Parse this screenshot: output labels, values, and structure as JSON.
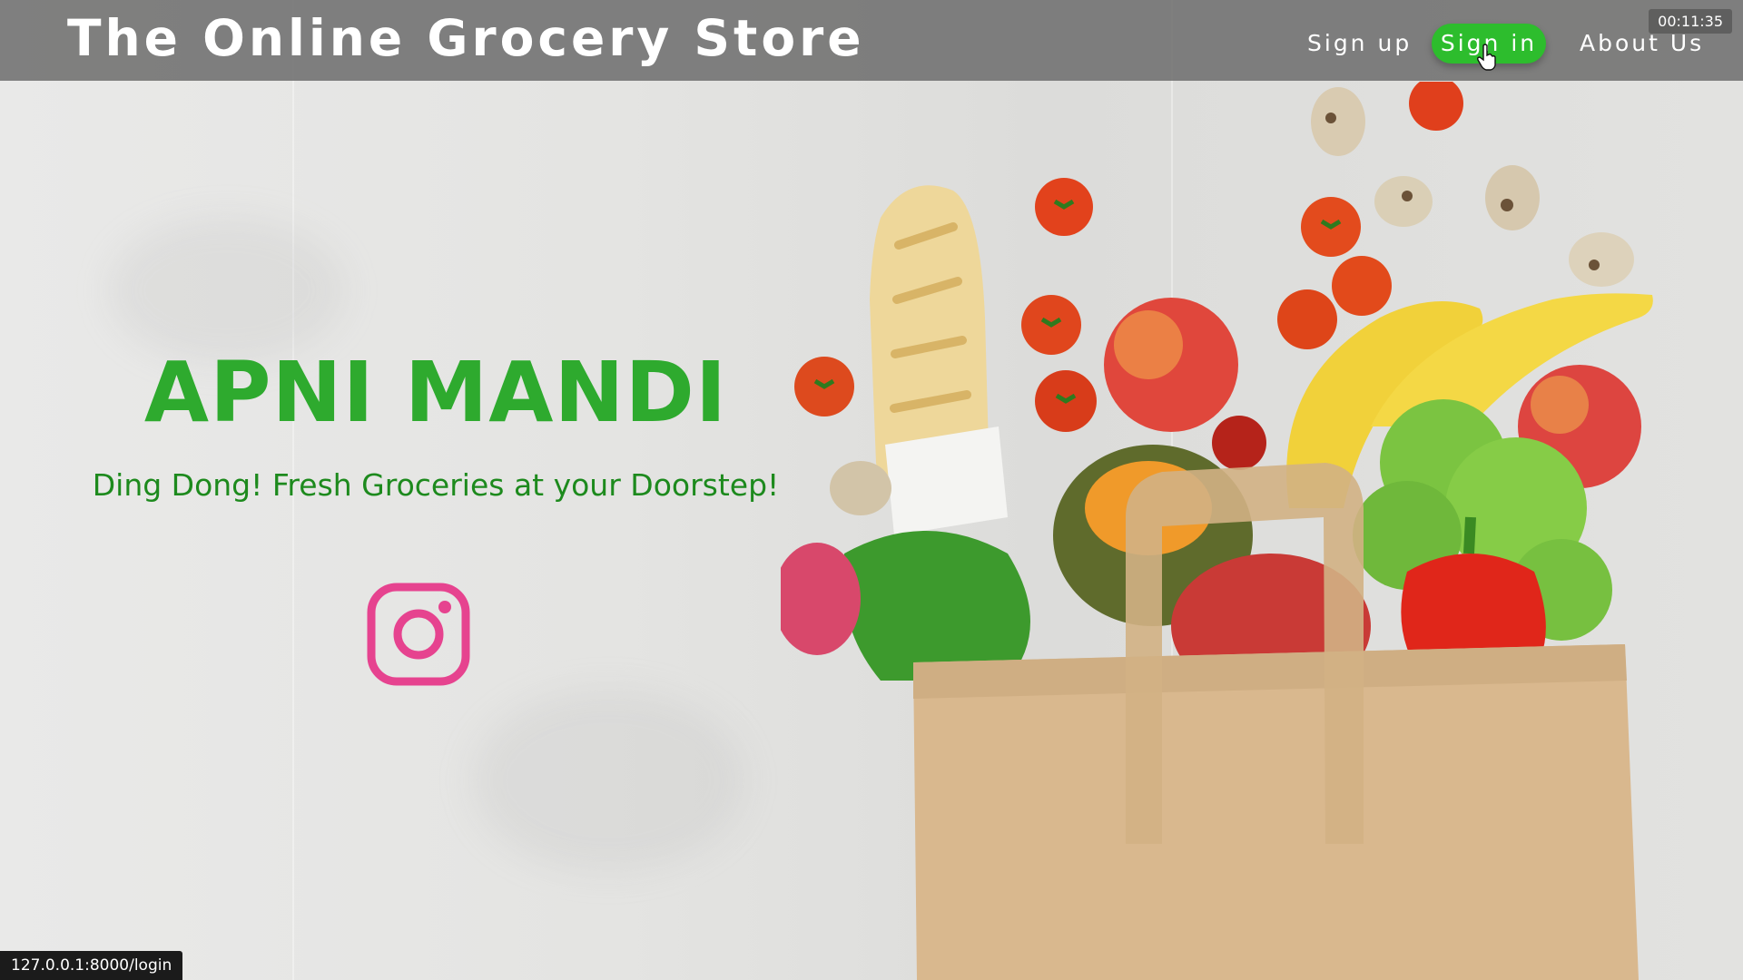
{
  "header": {
    "site_title": "The Online Grocery Store",
    "nav": {
      "signup": "Sign up",
      "signin": "Sign in",
      "about": "About Us"
    },
    "timer": "00:11:35"
  },
  "hero": {
    "title": "APNI MANDI",
    "tagline": "Ding Dong! Fresh Groceries at your Doorstep!"
  },
  "icons": {
    "instagram": "instagram-icon",
    "cursor": "hand-pointer-icon"
  },
  "status_bar": {
    "url": "127.0.0.1:8000/login"
  },
  "colors": {
    "accent_green": "#2eaa2e",
    "tagline_green": "#1d8a1d",
    "signin_button": "#2dbd2d",
    "header_bg": "#707070",
    "instagram_pink": "#e6438f"
  }
}
